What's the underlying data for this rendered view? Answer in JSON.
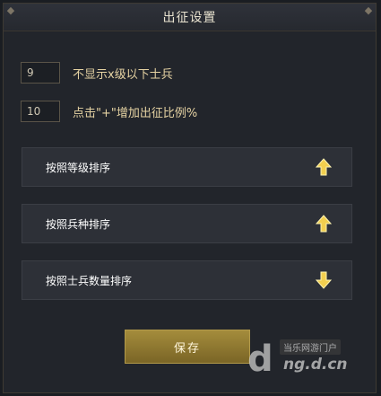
{
  "dialog": {
    "title": "出征设置"
  },
  "settings": [
    {
      "value": "9",
      "label": "不显示x级以下士兵"
    },
    {
      "value": "10",
      "label": "点击\"+\"增加出征比例%"
    }
  ],
  "sort_options": [
    {
      "label": "按照等级排序",
      "direction": "up",
      "icon": "arrow-up-icon"
    },
    {
      "label": "按照兵种排序",
      "direction": "up",
      "icon": "arrow-up-icon"
    },
    {
      "label": "按照士兵数量排序",
      "direction": "down",
      "icon": "arrow-down-icon"
    }
  ],
  "save_label": "保存",
  "watermark": {
    "top": "当乐网游门户",
    "bottom": "ng.d.cn"
  },
  "colors": {
    "accent_gold": "#e6c34a",
    "label_gold": "#e6d3a3",
    "button_gold": "#8f7a33"
  }
}
